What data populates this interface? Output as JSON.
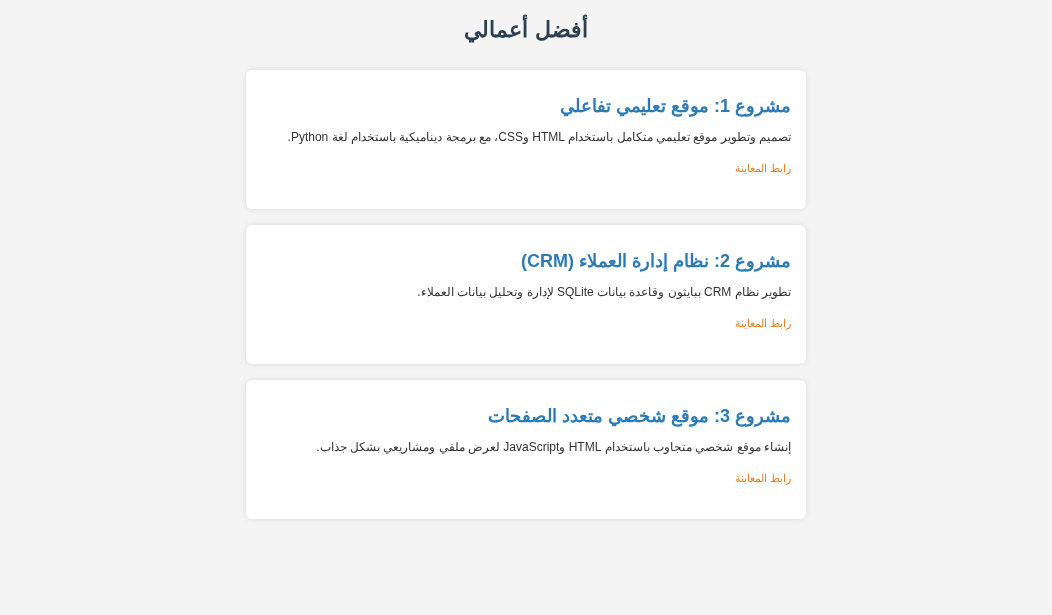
{
  "heading": "أفضل أعمالي",
  "projects": [
    {
      "title": "مشروع 1: موقع تعليمي تفاعلي",
      "description": "تصميم وتطوير موقع تعليمي متكامل باستخدام HTML وCSS، مع برمجة ديناميكية باستخدام لغة Python.",
      "link": "رابط المعاينة"
    },
    {
      "title": "مشروع 2: نظام إدارة العملاء (CRM)",
      "description": "تطوير نظام CRM ببايثون وقاعدة بيانات SQLite لإدارة وتحليل بيانات العملاء.",
      "link": "رابط المعاينة"
    },
    {
      "title": "مشروع 3: موقع شخصي متعدد الصفحات",
      "description": "إنشاء موقع شخصي متجاوب باستخدام HTML وJavaScript لعرض ملفي ومشاريعي بشكل جذاب.",
      "link": "رابط المعاينة"
    }
  ]
}
